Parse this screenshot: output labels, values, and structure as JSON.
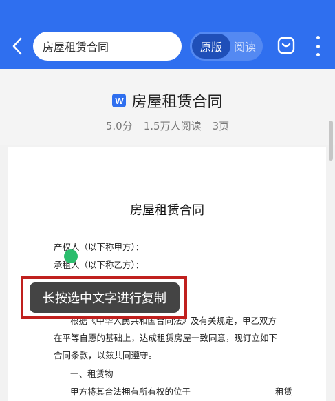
{
  "header": {
    "search_text": "房屋租赁合同",
    "toggle": {
      "active": "原版",
      "inactive": "阅读"
    },
    "accent_color": "#2f6fef",
    "icons": [
      "chevron-left-icon",
      "bag-icon",
      "more-vertical-icon"
    ]
  },
  "doc_info": {
    "badge": "W",
    "title": "房屋租赁合同",
    "rating": "5.0分",
    "reads": "1.5万人阅读",
    "pages": "3页"
  },
  "page": {
    "title": "房屋租赁合同",
    "party_a": "产权人（以下称甲方）：",
    "party_b": "承租人（以下称乙方）：",
    "p1_line1": "根据《中华人民共和国合同法》及有关规定，甲乙双方",
    "p1_line2": "在平等自愿的基础上，达成租赁房屋一致同意，现订立如下",
    "p1_line3": "合同条款，以兹共同遵守。",
    "section1": "一、租赁物",
    "s1_line1": "甲方将其合法拥有所有权的位于",
    "s1_line1_end": "租赁"
  },
  "tooltip": {
    "text": "长按选中文字进行复制",
    "frame_color": "#c0201e"
  }
}
